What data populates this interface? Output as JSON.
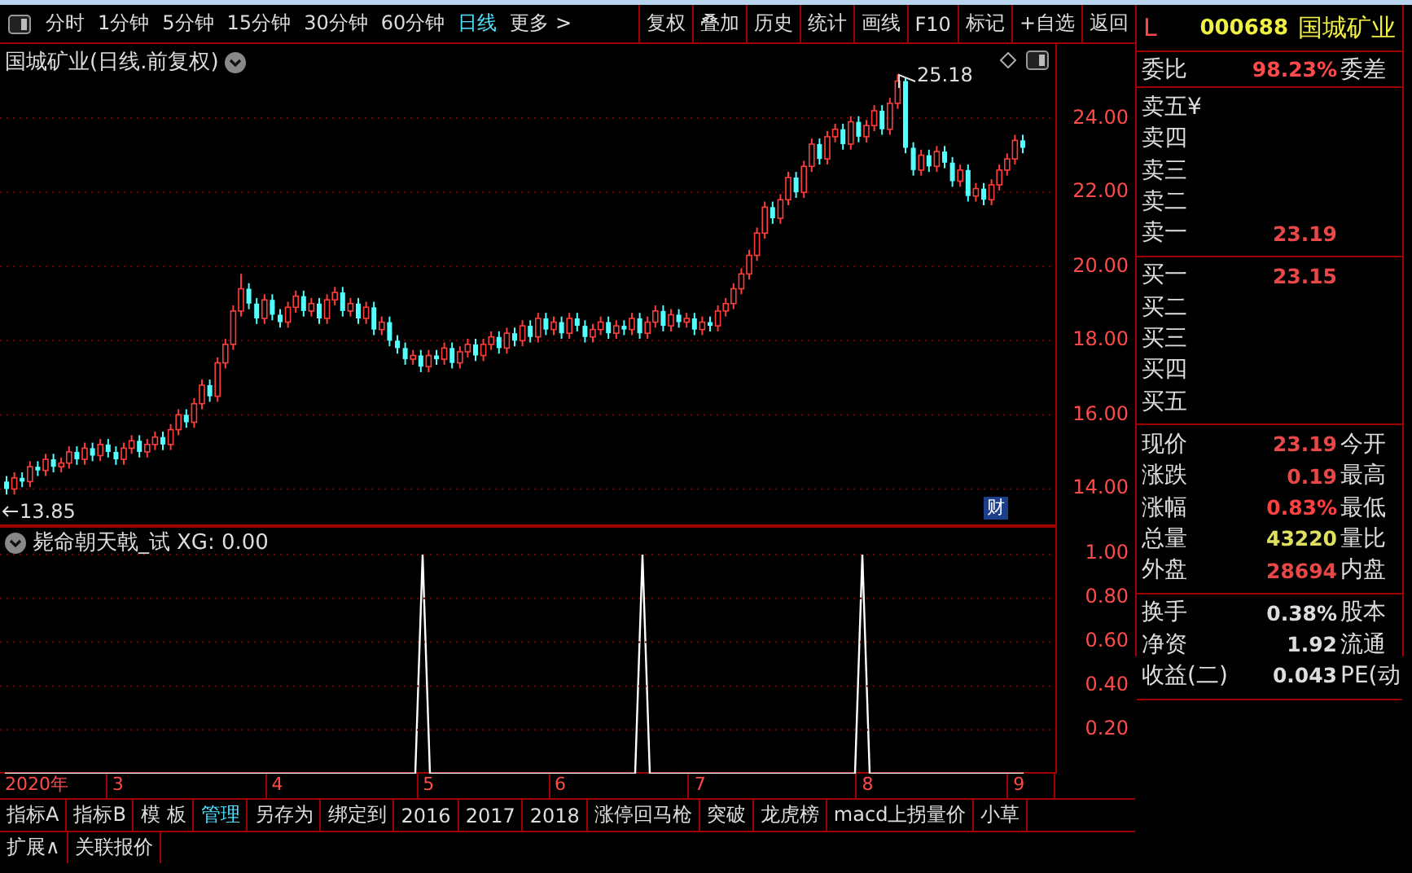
{
  "toolbar": {
    "periods": [
      {
        "label": "分时",
        "selected": false
      },
      {
        "label": "1分钟",
        "selected": false
      },
      {
        "label": "5分钟",
        "selected": false
      },
      {
        "label": "15分钟",
        "selected": false
      },
      {
        "label": "30分钟",
        "selected": false
      },
      {
        "label": "60分钟",
        "selected": false
      },
      {
        "label": "日线",
        "selected": true
      },
      {
        "label": "更多 >",
        "selected": false
      }
    ],
    "buttons": [
      "复权",
      "叠加",
      "历史",
      "统计",
      "画线",
      "F10",
      "标记",
      "+自选",
      "返回"
    ]
  },
  "price_chart": {
    "title": "国城矿业(日线.前复权)",
    "high_label": "25.18",
    "low_label": "13.85",
    "badge": "财",
    "chart_data": {
      "type": "candlestick",
      "grid": true,
      "ylim": [
        13,
        26
      ],
      "yticks": [
        {
          "value": 24,
          "label": "24.00"
        },
        {
          "value": 22,
          "label": "22.00"
        },
        {
          "value": 20,
          "label": "20.00"
        },
        {
          "value": 18,
          "label": "18.00"
        },
        {
          "value": 16,
          "label": "16.00"
        },
        {
          "value": 14,
          "label": "14.00"
        }
      ],
      "ohlc": [
        [
          14.2,
          14.35,
          13.85,
          14.0
        ],
        [
          14.0,
          14.45,
          13.85,
          14.3
        ],
        [
          14.3,
          14.45,
          14.05,
          14.2
        ],
        [
          14.2,
          14.75,
          14.05,
          14.6
        ],
        [
          14.6,
          14.75,
          14.35,
          14.5
        ],
        [
          14.5,
          14.95,
          14.35,
          14.8
        ],
        [
          14.8,
          14.95,
          14.45,
          14.6
        ],
        [
          14.6,
          14.85,
          14.45,
          14.7
        ],
        [
          14.7,
          15.15,
          14.55,
          15.0
        ],
        [
          15.0,
          15.15,
          14.65,
          14.8
        ],
        [
          14.8,
          15.25,
          14.65,
          15.1
        ],
        [
          15.1,
          15.25,
          14.75,
          14.9
        ],
        [
          14.9,
          15.35,
          14.75,
          15.2
        ],
        [
          15.2,
          15.35,
          14.85,
          15.0
        ],
        [
          15.0,
          15.15,
          14.65,
          14.8
        ],
        [
          14.8,
          15.25,
          14.65,
          15.1
        ],
        [
          15.1,
          15.45,
          14.95,
          15.3
        ],
        [
          15.3,
          15.45,
          14.85,
          15.0
        ],
        [
          15.0,
          15.35,
          14.85,
          15.2
        ],
        [
          15.2,
          15.55,
          15.05,
          15.4
        ],
        [
          15.4,
          15.55,
          15.05,
          15.2
        ],
        [
          15.2,
          15.75,
          15.05,
          15.6
        ],
        [
          15.6,
          16.15,
          15.45,
          16.0
        ],
        [
          16.0,
          16.15,
          15.65,
          15.8
        ],
        [
          15.8,
          16.45,
          15.65,
          16.3
        ],
        [
          16.3,
          16.95,
          16.15,
          16.8
        ],
        [
          16.8,
          16.95,
          16.35,
          16.5
        ],
        [
          16.5,
          17.55,
          16.35,
          17.4
        ],
        [
          17.4,
          18.05,
          17.25,
          17.9
        ],
        [
          17.9,
          18.95,
          17.75,
          18.8
        ],
        [
          18.8,
          19.8,
          18.65,
          19.4
        ],
        [
          19.4,
          19.55,
          18.85,
          19.0
        ],
        [
          19.0,
          19.15,
          18.45,
          18.6
        ],
        [
          18.6,
          19.25,
          18.45,
          19.1
        ],
        [
          19.1,
          19.25,
          18.55,
          18.7
        ],
        [
          18.7,
          18.85,
          18.35,
          18.5
        ],
        [
          18.5,
          19.05,
          18.35,
          18.9
        ],
        [
          18.9,
          19.35,
          18.75,
          19.2
        ],
        [
          19.2,
          19.35,
          18.65,
          18.8
        ],
        [
          18.8,
          19.15,
          18.65,
          19.0
        ],
        [
          19.0,
          19.15,
          18.45,
          18.6
        ],
        [
          18.6,
          19.25,
          18.45,
          19.1
        ],
        [
          19.1,
          19.45,
          18.95,
          19.3
        ],
        [
          19.3,
          19.45,
          18.65,
          18.8
        ],
        [
          18.8,
          19.15,
          18.65,
          19.0
        ],
        [
          19.0,
          19.15,
          18.45,
          18.6
        ],
        [
          18.6,
          19.05,
          18.45,
          18.9
        ],
        [
          18.9,
          19.05,
          18.15,
          18.3
        ],
        [
          18.3,
          18.65,
          18.15,
          18.5
        ],
        [
          18.5,
          18.65,
          17.85,
          18.0
        ],
        [
          18.0,
          18.15,
          17.65,
          17.8
        ],
        [
          17.8,
          17.95,
          17.35,
          17.5
        ],
        [
          17.5,
          17.75,
          17.35,
          17.6
        ],
        [
          17.6,
          17.75,
          17.15,
          17.3
        ],
        [
          17.3,
          17.75,
          17.15,
          17.6
        ],
        [
          17.6,
          17.75,
          17.35,
          17.5
        ],
        [
          17.5,
          17.95,
          17.35,
          17.8
        ],
        [
          17.8,
          17.95,
          17.25,
          17.4
        ],
        [
          17.4,
          17.85,
          17.25,
          17.7
        ],
        [
          17.7,
          18.05,
          17.55,
          17.9
        ],
        [
          17.9,
          18.05,
          17.45,
          17.6
        ],
        [
          17.6,
          18.05,
          17.45,
          17.9
        ],
        [
          17.9,
          18.25,
          17.75,
          18.1
        ],
        [
          18.1,
          18.25,
          17.65,
          17.8
        ],
        [
          17.8,
          18.35,
          17.65,
          18.2
        ],
        [
          18.2,
          18.35,
          17.85,
          18.0
        ],
        [
          18.0,
          18.55,
          17.85,
          18.4
        ],
        [
          18.4,
          18.55,
          17.95,
          18.1
        ],
        [
          18.1,
          18.75,
          17.95,
          18.6
        ],
        [
          18.6,
          18.75,
          18.15,
          18.3
        ],
        [
          18.3,
          18.65,
          18.15,
          18.5
        ],
        [
          18.5,
          18.65,
          18.05,
          18.2
        ],
        [
          18.2,
          18.75,
          18.05,
          18.6
        ],
        [
          18.6,
          18.75,
          18.25,
          18.4
        ],
        [
          18.4,
          18.55,
          17.95,
          18.1
        ],
        [
          18.1,
          18.45,
          17.95,
          18.3
        ],
        [
          18.3,
          18.65,
          18.15,
          18.5
        ],
        [
          18.5,
          18.65,
          18.05,
          18.2
        ],
        [
          18.2,
          18.55,
          18.05,
          18.4
        ],
        [
          18.4,
          18.55,
          18.15,
          18.3
        ],
        [
          18.3,
          18.75,
          18.15,
          18.6
        ],
        [
          18.6,
          18.75,
          18.05,
          18.2
        ],
        [
          18.2,
          18.65,
          18.05,
          18.5
        ],
        [
          18.5,
          18.95,
          18.35,
          18.8
        ],
        [
          18.8,
          18.95,
          18.25,
          18.4
        ],
        [
          18.4,
          18.85,
          18.25,
          18.7
        ],
        [
          18.7,
          18.85,
          18.35,
          18.5
        ],
        [
          18.5,
          18.75,
          18.35,
          18.6
        ],
        [
          18.6,
          18.75,
          18.15,
          18.3
        ],
        [
          18.3,
          18.65,
          18.15,
          18.5
        ],
        [
          18.5,
          18.65,
          18.25,
          18.4
        ],
        [
          18.4,
          18.95,
          18.25,
          18.8
        ],
        [
          18.8,
          19.15,
          18.65,
          19.0
        ],
        [
          19.0,
          19.55,
          18.85,
          19.4
        ],
        [
          19.4,
          19.95,
          19.25,
          19.8
        ],
        [
          19.8,
          20.45,
          19.65,
          20.3
        ],
        [
          20.3,
          21.05,
          20.15,
          20.9
        ],
        [
          20.9,
          21.75,
          20.75,
          21.6
        ],
        [
          21.6,
          21.75,
          21.15,
          21.3
        ],
        [
          21.3,
          21.95,
          21.15,
          21.8
        ],
        [
          21.8,
          22.55,
          21.65,
          22.4
        ],
        [
          22.4,
          22.55,
          21.85,
          22.0
        ],
        [
          22.0,
          22.85,
          21.85,
          22.7
        ],
        [
          22.7,
          23.45,
          22.55,
          23.3
        ],
        [
          23.3,
          23.45,
          22.75,
          22.9
        ],
        [
          22.9,
          23.65,
          22.75,
          23.5
        ],
        [
          23.5,
          23.85,
          23.35,
          23.7
        ],
        [
          23.7,
          23.85,
          23.15,
          23.3
        ],
        [
          23.3,
          24.05,
          23.15,
          23.9
        ],
        [
          23.9,
          24.05,
          23.35,
          23.5
        ],
        [
          23.5,
          23.95,
          23.35,
          23.8
        ],
        [
          23.8,
          24.35,
          23.65,
          24.2
        ],
        [
          24.2,
          24.35,
          23.55,
          23.7
        ],
        [
          23.7,
          24.55,
          23.55,
          24.4
        ],
        [
          24.4,
          25.18,
          24.25,
          25.0
        ],
        [
          25.0,
          25.1,
          23.05,
          23.2
        ],
        [
          23.2,
          23.35,
          22.45,
          22.6
        ],
        [
          22.6,
          23.15,
          22.45,
          23.0
        ],
        [
          23.0,
          23.15,
          22.55,
          22.7
        ],
        [
          22.7,
          23.25,
          22.55,
          23.1
        ],
        [
          23.1,
          23.25,
          22.65,
          22.8
        ],
        [
          22.8,
          22.95,
          22.15,
          22.3
        ],
        [
          22.3,
          22.75,
          22.15,
          22.6
        ],
        [
          22.6,
          22.75,
          21.75,
          21.9
        ],
        [
          21.9,
          22.25,
          21.75,
          22.1
        ],
        [
          22.1,
          22.25,
          21.65,
          21.8
        ],
        [
          21.8,
          22.35,
          21.65,
          22.2
        ],
        [
          22.2,
          22.75,
          22.05,
          22.6
        ],
        [
          22.6,
          23.05,
          22.45,
          22.9
        ],
        [
          22.9,
          23.55,
          22.75,
          23.4
        ],
        [
          23.4,
          23.55,
          23.05,
          23.2
        ]
      ]
    }
  },
  "indicator": {
    "name": "毙命朝天戟_试",
    "reading": "XG: 0.00",
    "chart_data": {
      "type": "line",
      "grid": true,
      "ylim": [
        0,
        1.13
      ],
      "yticks": [
        {
          "value": 1,
          "label": "1.00"
        },
        {
          "value": 0.8,
          "label": "0.80"
        },
        {
          "value": 0.6,
          "label": "0.60"
        },
        {
          "value": 0.4,
          "label": "0.40"
        },
        {
          "value": 0.2,
          "label": "0.20"
        }
      ],
      "series": [
        {
          "color": "#ffffff",
          "values": [
            0,
            0,
            0,
            0,
            0,
            0,
            0,
            0,
            0,
            0,
            0,
            0,
            0,
            0,
            0,
            0,
            0,
            0,
            0,
            0,
            0,
            0,
            0,
            0,
            0,
            0,
            0,
            0,
            0,
            0,
            0,
            0,
            0,
            0,
            0,
            0,
            0,
            0,
            0,
            0,
            0,
            0,
            0,
            0,
            0,
            0,
            0,
            0,
            0,
            0,
            0,
            0,
            0,
            0,
            0,
            0,
            0,
            1,
            0,
            0,
            0,
            0,
            0,
            0,
            0,
            0,
            0,
            0,
            0,
            0,
            0,
            0,
            0,
            0,
            0,
            0,
            0,
            0,
            0,
            0,
            0,
            0,
            0,
            0,
            0,
            0,
            0,
            1,
            0,
            0,
            0,
            0,
            0,
            0,
            0,
            0,
            0,
            0,
            0,
            0,
            0,
            0,
            0,
            0,
            0,
            0,
            0,
            0,
            0,
            0,
            0,
            0,
            0,
            0,
            0,
            0,
            0,
            1,
            0,
            0,
            0,
            0,
            0,
            0,
            0,
            0,
            0,
            0,
            0,
            0,
            0,
            0,
            0,
            0,
            0,
            0,
            0,
            0,
            0,
            0
          ]
        }
      ]
    }
  },
  "date_axis": [
    "2020年",
    "3",
    "4",
    "5",
    "6",
    "7",
    "8",
    "9"
  ],
  "bottom_tabs": [
    {
      "label": "指标A",
      "selected": false
    },
    {
      "label": "指标B",
      "selected": false
    },
    {
      "label": "模 板",
      "selected": false
    },
    {
      "label": "管理",
      "selected": true
    },
    {
      "label": "另存为",
      "selected": false
    },
    {
      "label": "绑定到",
      "selected": false
    },
    {
      "label": "2016",
      "selected": false
    },
    {
      "label": "2017",
      "selected": false
    },
    {
      "label": "2018",
      "selected": false
    },
    {
      "label": "涨停回马枪",
      "selected": false
    },
    {
      "label": "突破",
      "selected": false
    },
    {
      "label": "龙虎榜",
      "selected": false
    },
    {
      "label": "macd上拐量价",
      "selected": false
    },
    {
      "label": "小草",
      "selected": false
    }
  ],
  "bottom_links": [
    "扩展∧",
    "关联报价"
  ],
  "quote": {
    "market": "L",
    "code": "000688",
    "name": "国城矿业",
    "ratio_label": "委比",
    "ratio": "98.23%",
    "diff_label": "委差",
    "asks": [
      {
        "label": "卖五¥"
      },
      {
        "label": "卖四"
      },
      {
        "label": "卖三"
      },
      {
        "label": "卖二"
      },
      {
        "label": "卖一",
        "price": "23.19"
      }
    ],
    "bids": [
      {
        "label": "买一",
        "price": "23.15"
      },
      {
        "label": "买二"
      },
      {
        "label": "买三"
      },
      {
        "label": "买四"
      },
      {
        "label": "买五"
      }
    ],
    "stats": [
      {
        "label": "现价",
        "value": "23.19",
        "color": "#e84848",
        "label2": "今开"
      },
      {
        "label": "涨跌",
        "value": "0.19",
        "color": "#e84848",
        "label2": "最高"
      },
      {
        "label": "涨幅",
        "value": "0.83%",
        "color": "#ff4040",
        "label2": "最低"
      },
      {
        "label": "总量",
        "value": "43220",
        "color": "#e0e060",
        "label2": "量比"
      },
      {
        "label": "外盘",
        "value": "28694",
        "color": "#e84848",
        "label2": "内盘"
      }
    ],
    "finance": [
      {
        "label": "换手",
        "value": "0.38%",
        "color": "#dddddd",
        "label2": "股本"
      },
      {
        "label": "净资",
        "value": "1.92",
        "color": "#dddddd",
        "label2": "流通"
      },
      {
        "label": "收益(二)",
        "value": "0.043",
        "color": "#dddddd",
        "label2": "PE(动"
      }
    ]
  }
}
